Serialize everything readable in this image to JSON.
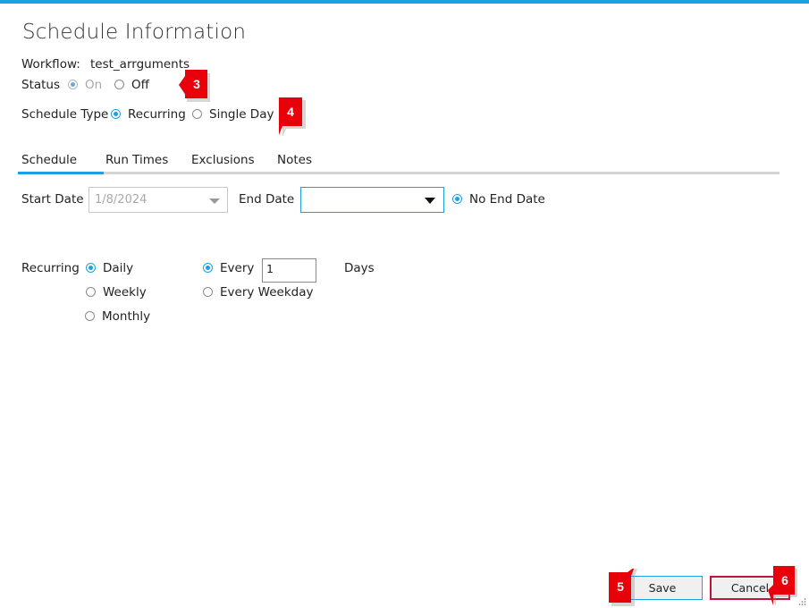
{
  "dialog": {
    "title": "Schedule Information"
  },
  "workflow": {
    "label": "Workflow:",
    "value": "test_arrguments"
  },
  "status": {
    "label": "Status",
    "options": [
      "On",
      "Off"
    ],
    "selected": "On"
  },
  "schedule_type": {
    "label": "Schedule Type",
    "options": [
      "Recurring",
      "Single Day"
    ],
    "selected": "Recurring"
  },
  "tabs": {
    "items": [
      "Schedule",
      "Run Times",
      "Exclusions",
      "Notes"
    ],
    "active": "Schedule"
  },
  "dates": {
    "start_label": "Start Date",
    "start_value": "1/8/2024",
    "end_label": "End Date",
    "end_value": "",
    "no_end_label": "No End Date"
  },
  "recurring": {
    "label": "Recurring",
    "frequency_options": [
      "Daily",
      "Weekly",
      "Monthly"
    ],
    "frequency_selected": "Daily",
    "every_label": "Every",
    "every_value": "1",
    "unit_label": "Days",
    "weekday_label": "Every Weekday"
  },
  "buttons": {
    "save": "Save",
    "cancel": "Cancel"
  },
  "callouts": [
    "3",
    "4",
    "5",
    "6"
  ],
  "colors": {
    "accent": "#1ba1e2",
    "callout": "#e8000a",
    "cancel_border": "#c0143c"
  }
}
